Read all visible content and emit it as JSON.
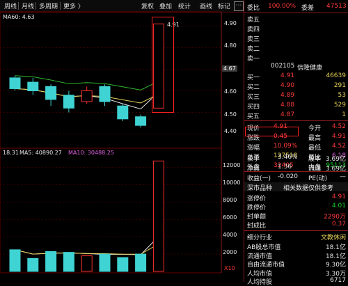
{
  "toolbar": {
    "left_items": [
      "周线",
      "月线",
      "多周期",
      "更多"
    ],
    "right_items": [
      "复权",
      "叠加",
      "统计",
      "画线",
      "标记"
    ],
    "dropdown_glyph": "〉"
  },
  "kline": {
    "ma_label": "MA60: 4.63",
    "price_marker": "4.91",
    "current_price_tag": "4.67",
    "y_ticks": [
      "4.90",
      "4.80",
      "4.70",
      "4.60",
      "4.50",
      "4.40"
    ]
  },
  "volume": {
    "label_prefix": "18.31",
    "ma5_label": "MA5: 40890.27",
    "ma10_label": "MA10: 30488.25",
    "y_ticks": [
      "12000",
      "10000",
      "8000",
      "6000",
      "4000",
      "2000"
    ],
    "unit": "X10"
  },
  "quote": {
    "webi_label": "委比",
    "webi_value": "100.00%",
    "weicha_label": "委差",
    "weicha_value": "47513",
    "sell_levels": [
      "卖五",
      "卖四",
      "卖三",
      "卖二",
      "卖一"
    ],
    "stock_code": "002105",
    "stock_name": "信隆健康",
    "buy_levels": [
      {
        "label": "买一",
        "price": "4.91",
        "vol": "46639"
      },
      {
        "label": "买二",
        "price": "4.90",
        "vol": "291"
      },
      {
        "label": "买三",
        "price": "4.89",
        "vol": "53"
      },
      {
        "label": "买四",
        "price": "4.88",
        "vol": "529"
      },
      {
        "label": "买五",
        "price": "4.87",
        "vol": "1"
      }
    ],
    "stats": [
      {
        "l1": "现价",
        "v1": "4.91",
        "l2": "今开",
        "v2": "4.52"
      },
      {
        "l1": "涨跌",
        "v1": "0.45",
        "l2": "最高",
        "v2": "4.91"
      },
      {
        "l1": "涨幅",
        "v1": "10.09%",
        "l2": "最低",
        "v2": "4.52"
      },
      {
        "l1": "总量",
        "v1": "127518",
        "l2": "量比",
        "v2": "6.18"
      },
      {
        "l1": "外盘",
        "v1": "32405",
        "l2": "内盘",
        "v2": "95113"
      }
    ],
    "stats2": [
      {
        "l1": "换手",
        "v1": "3.46%",
        "l2": "股本",
        "v2": "3.69亿"
      },
      {
        "l1": "净资",
        "v1": "1.36",
        "l2": "流通",
        "v2": "3.69亿"
      },
      {
        "l1": "收益(一)",
        "v1": "-0.020",
        "l2": "PE(动)",
        "v2": "—"
      }
    ],
    "board_title": "深市品种",
    "board_note": "相关数据仅供参考",
    "limits": [
      {
        "label": "涨停价",
        "value": "4.91"
      },
      {
        "label": "跌停价",
        "value": "4.01"
      },
      {
        "label": "封单额",
        "value": "2290万"
      },
      {
        "label": "封成比",
        "value": "0.37"
      }
    ],
    "industry_label": "细分行业",
    "industry_value": "文教休闲",
    "caps": [
      {
        "label": "AB股总市值",
        "value": "18.1亿"
      },
      {
        "label": "流通市值",
        "value": "18.1亿"
      },
      {
        "label": "自由流通市值",
        "value": "9.30亿"
      },
      {
        "label": "人均市值",
        "value": "3.30万"
      },
      {
        "label": "人均持股",
        "value": "6717"
      }
    ]
  },
  "chart_data": {
    "type": "candlestick",
    "candles": [
      {
        "o": 4.66,
        "c": 4.61,
        "h": 4.67,
        "l": 4.6,
        "v": 2500
      },
      {
        "o": 4.64,
        "c": 4.6,
        "h": 4.66,
        "l": 4.58,
        "v": 1500
      },
      {
        "o": 4.62,
        "c": 4.56,
        "h": 4.63,
        "l": 4.53,
        "v": 2300
      },
      {
        "o": 4.58,
        "c": 4.52,
        "h": 4.6,
        "l": 4.5,
        "v": 2200
      },
      {
        "o": 4.55,
        "c": 4.6,
        "h": 4.62,
        "l": 4.54,
        "v": 1800
      },
      {
        "o": 4.62,
        "c": 4.55,
        "h": 4.63,
        "l": 4.53,
        "v": 2000
      },
      {
        "o": 4.53,
        "c": 4.47,
        "h": 4.54,
        "l": 4.46,
        "v": 1600
      },
      {
        "o": 4.48,
        "c": 4.44,
        "h": 4.49,
        "l": 4.43,
        "v": 2000
      },
      {
        "o": 4.52,
        "c": 4.91,
        "h": 4.91,
        "l": 4.52,
        "v": 12750
      }
    ],
    "price_ylim": [
      4.36,
      4.94
    ],
    "vol_ylim": [
      0,
      13500
    ]
  }
}
